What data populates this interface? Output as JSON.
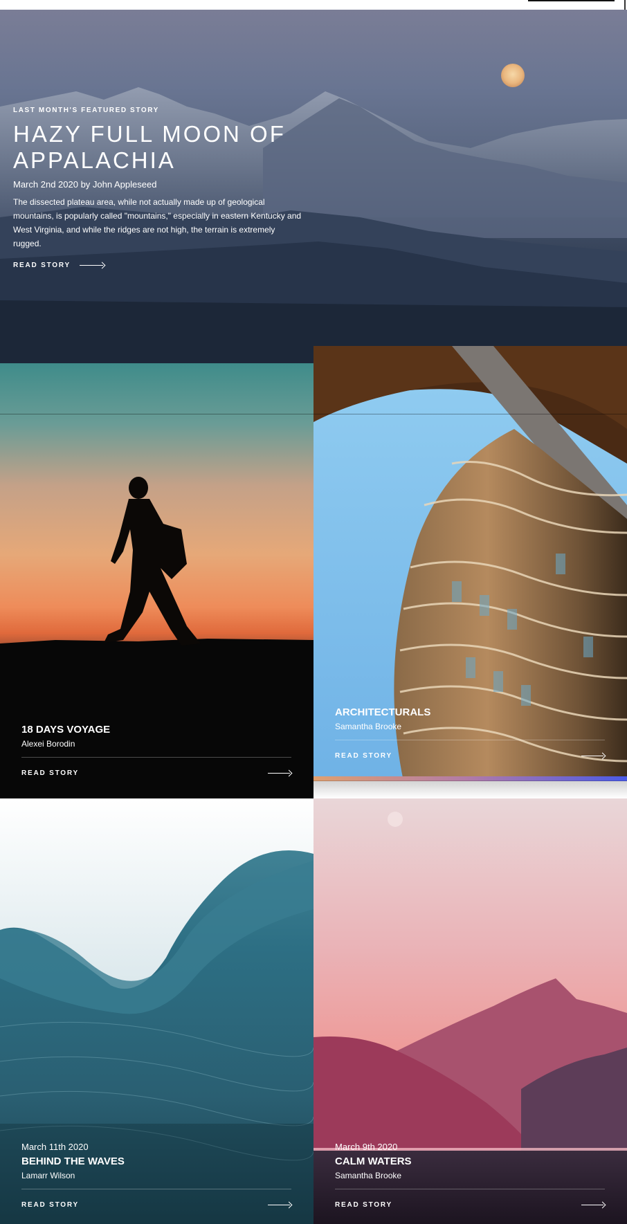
{
  "hero": {
    "eyebrow": "LAST MONTH'S FEATURED STORY",
    "title_line1": "HAZY FULL MOON OF",
    "title_line2": "APPALACHIA",
    "meta": "March 2nd 2020 by John Appleseed",
    "description": "The dissected plateau area, while not actually made up of geological mountains, is popularly called \"mountains,\" especially in eastern Kentucky and West Virginia, and while the ridges are not high, the terrain is extremely rugged.",
    "read_label": "READ STORY",
    "image": "mountains-full-moon"
  },
  "cards": [
    {
      "date": "",
      "title": "18 DAYS VOYAGE",
      "author": "Alexei Borodin",
      "read_label": "READ STORY",
      "image": "hiker-silhouette-sunset"
    },
    {
      "date": "",
      "title": "ARCHITECTURALS",
      "author": "Samantha Brooke",
      "read_label": "READ STORY",
      "image": "curved-building"
    },
    {
      "date": "March 11th 2020",
      "title": "BEHIND THE WAVES",
      "author": "Lamarr Wilson",
      "read_label": "READ STORY",
      "image": "ocean-wave"
    },
    {
      "date": "March 9th 2020",
      "title": "CALM WATERS",
      "author": "Samantha Brooke",
      "read_label": "READ STORY",
      "image": "pink-lake-mountains"
    }
  ],
  "colors": {
    "accent_gradient_start": "#e0a070",
    "accent_gradient_end": "#4a5ae6"
  }
}
